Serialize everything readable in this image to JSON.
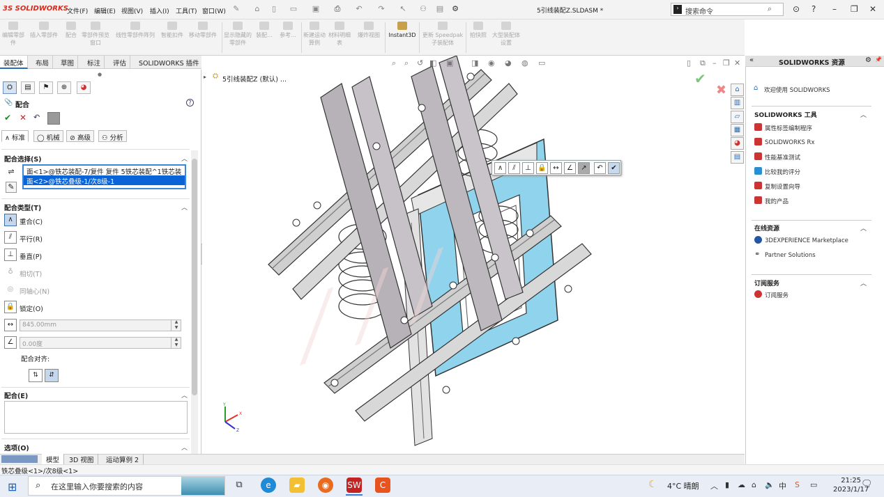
{
  "titlebar": {
    "logo": "3S SOLIDWORKS",
    "menus": [
      "文件(F)",
      "编辑(E)",
      "视图(V)",
      "插入(I)",
      "工具(T)",
      "窗口(W)"
    ],
    "doc_title": "5引线装配Z.SLDASM *",
    "search_placeholder": "搜索命令"
  },
  "ribbon": {
    "buttons": [
      "编辑零部件",
      "插入零部件",
      "配合",
      "零部件预览窗口",
      "线性零部件阵列",
      "智能扣件",
      "移动零部件",
      "显示隐藏的零部件",
      "装配...",
      "参考...",
      "新建运动算例",
      "材料明细表",
      "爆炸视图",
      "Instant3D",
      "更新 Speedpak 子装配体",
      "拍快照",
      "大型装配体设置"
    ]
  },
  "cm_tabs": [
    "装配体",
    "布局",
    "草图",
    "标注",
    "评估",
    "SOLIDWORKS 插件"
  ],
  "property_manager": {
    "title": "配合",
    "help": "?",
    "subtabs": [
      "标准",
      "机械",
      "高级",
      "分析"
    ],
    "sections": {
      "selection": "配合选择(S)",
      "type": "配合类型(T)",
      "mates": "配合(E)",
      "options": "选项(O)"
    },
    "selected_items": [
      "面<1>@铁芯装配-7/复件 复件 5铁芯装配^1铁芯装",
      "面<2>@铁芯叠级-1/次8级-1"
    ],
    "mate_types": [
      {
        "label": "重合(C)",
        "state": "selected",
        "icon": "coincident-icon"
      },
      {
        "label": "平行(R)",
        "state": "enabled",
        "icon": "parallel-icon"
      },
      {
        "label": "垂直(P)",
        "state": "enabled",
        "icon": "perpendicular-icon"
      },
      {
        "label": "相切(T)",
        "state": "disabled",
        "icon": "tangent-icon"
      },
      {
        "label": "同轴心(N)",
        "state": "disabled",
        "icon": "concentric-icon"
      },
      {
        "label": "锁定(O)",
        "state": "enabled",
        "icon": "lock-icon"
      }
    ],
    "distance_value": "845.00mm",
    "angle_value": "0.00度",
    "alignment_label": "配合对齐:"
  },
  "viewport": {
    "tree_label": "5引线装配Z (默认) ..."
  },
  "model_tabs": [
    "模型",
    "3D 视图",
    "运动算例 2"
  ],
  "status_text": "铁芯叠级<1>/次8级<1>",
  "task_pane": {
    "title": "SOLIDWORKS 资源",
    "welcome": "欢迎使用 SOLIDWORKS",
    "tools_header": "SOLIDWORKS 工具",
    "tools": [
      "属性标签编制程序",
      "SOLIDWORKS Rx",
      "性能基准测试",
      "比较我的评分",
      "复制设置向导",
      "我的产品"
    ],
    "online_header": "在线资源",
    "online": [
      "3DEXPERIENCE Marketplace",
      "Partner Solutions"
    ],
    "subscription_header": "订阅服务",
    "subscription": [
      "订阅服务"
    ]
  },
  "taskbar": {
    "search_placeholder": "在这里输入你要搜索的内容",
    "weather": "4°C  晴朗",
    "time": "21:25",
    "date": "2023/1/17"
  },
  "colors": {
    "accent": "#0a64d8",
    "brand": "#d52b1e",
    "frame_blue": "#8fd3ec"
  }
}
